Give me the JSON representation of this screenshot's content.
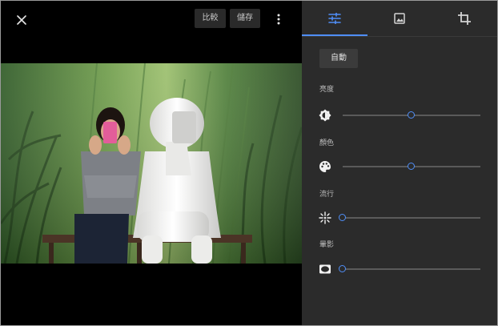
{
  "toolbar": {
    "compare_label": "比較",
    "save_label": "儲存"
  },
  "panel": {
    "auto_label": "自動",
    "accent": "#4f8ef7",
    "sections": [
      {
        "label": "亮度",
        "icon": "brightness-icon",
        "value": 0.5
      },
      {
        "label": "顏色",
        "icon": "palette-icon",
        "value": 0.5
      },
      {
        "label": "流行",
        "icon": "pop-icon",
        "value": 0
      },
      {
        "label": "暈影",
        "icon": "vignette-icon",
        "value": 0
      }
    ]
  }
}
